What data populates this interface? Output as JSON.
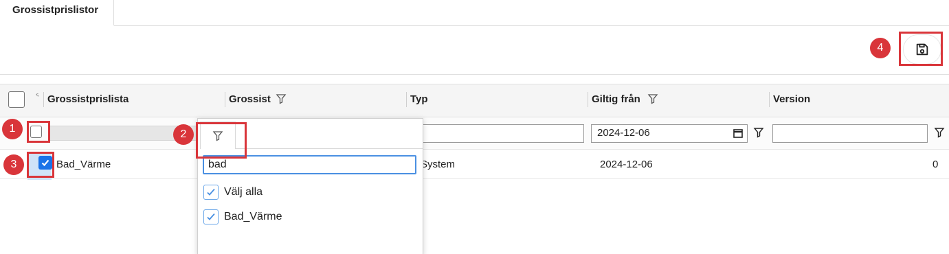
{
  "tabs": [
    {
      "label": "Grossistprislistor"
    }
  ],
  "toolbar": {
    "save_icon": "save-icon"
  },
  "grid": {
    "columns": [
      {
        "label": "Grossistprislista",
        "filter": false
      },
      {
        "label": "Grossist",
        "filter": true
      },
      {
        "label": "Typ",
        "filter": false
      },
      {
        "label": "Giltig från",
        "filter": true
      },
      {
        "label": "Version",
        "filter": false
      }
    ],
    "filters": {
      "typ_value": "",
      "giltig_fran_value": "2024-12-06",
      "version_value": ""
    },
    "rows": [
      {
        "name": "Bad_Värme",
        "typ": "System",
        "giltig_fran": "2024-12-06",
        "version": "0",
        "checked": true
      }
    ]
  },
  "filter_popup": {
    "search_value": "bad",
    "options": [
      {
        "label": "Välj alla",
        "checked": true
      },
      {
        "label": "Bad_Värme",
        "checked": true
      }
    ]
  },
  "annotations": [
    {
      "number": "1"
    },
    {
      "number": "2"
    },
    {
      "number": "3"
    },
    {
      "number": "4"
    }
  ],
  "colors": {
    "accent": "#1a73e8",
    "annotation": "#d9353a"
  }
}
